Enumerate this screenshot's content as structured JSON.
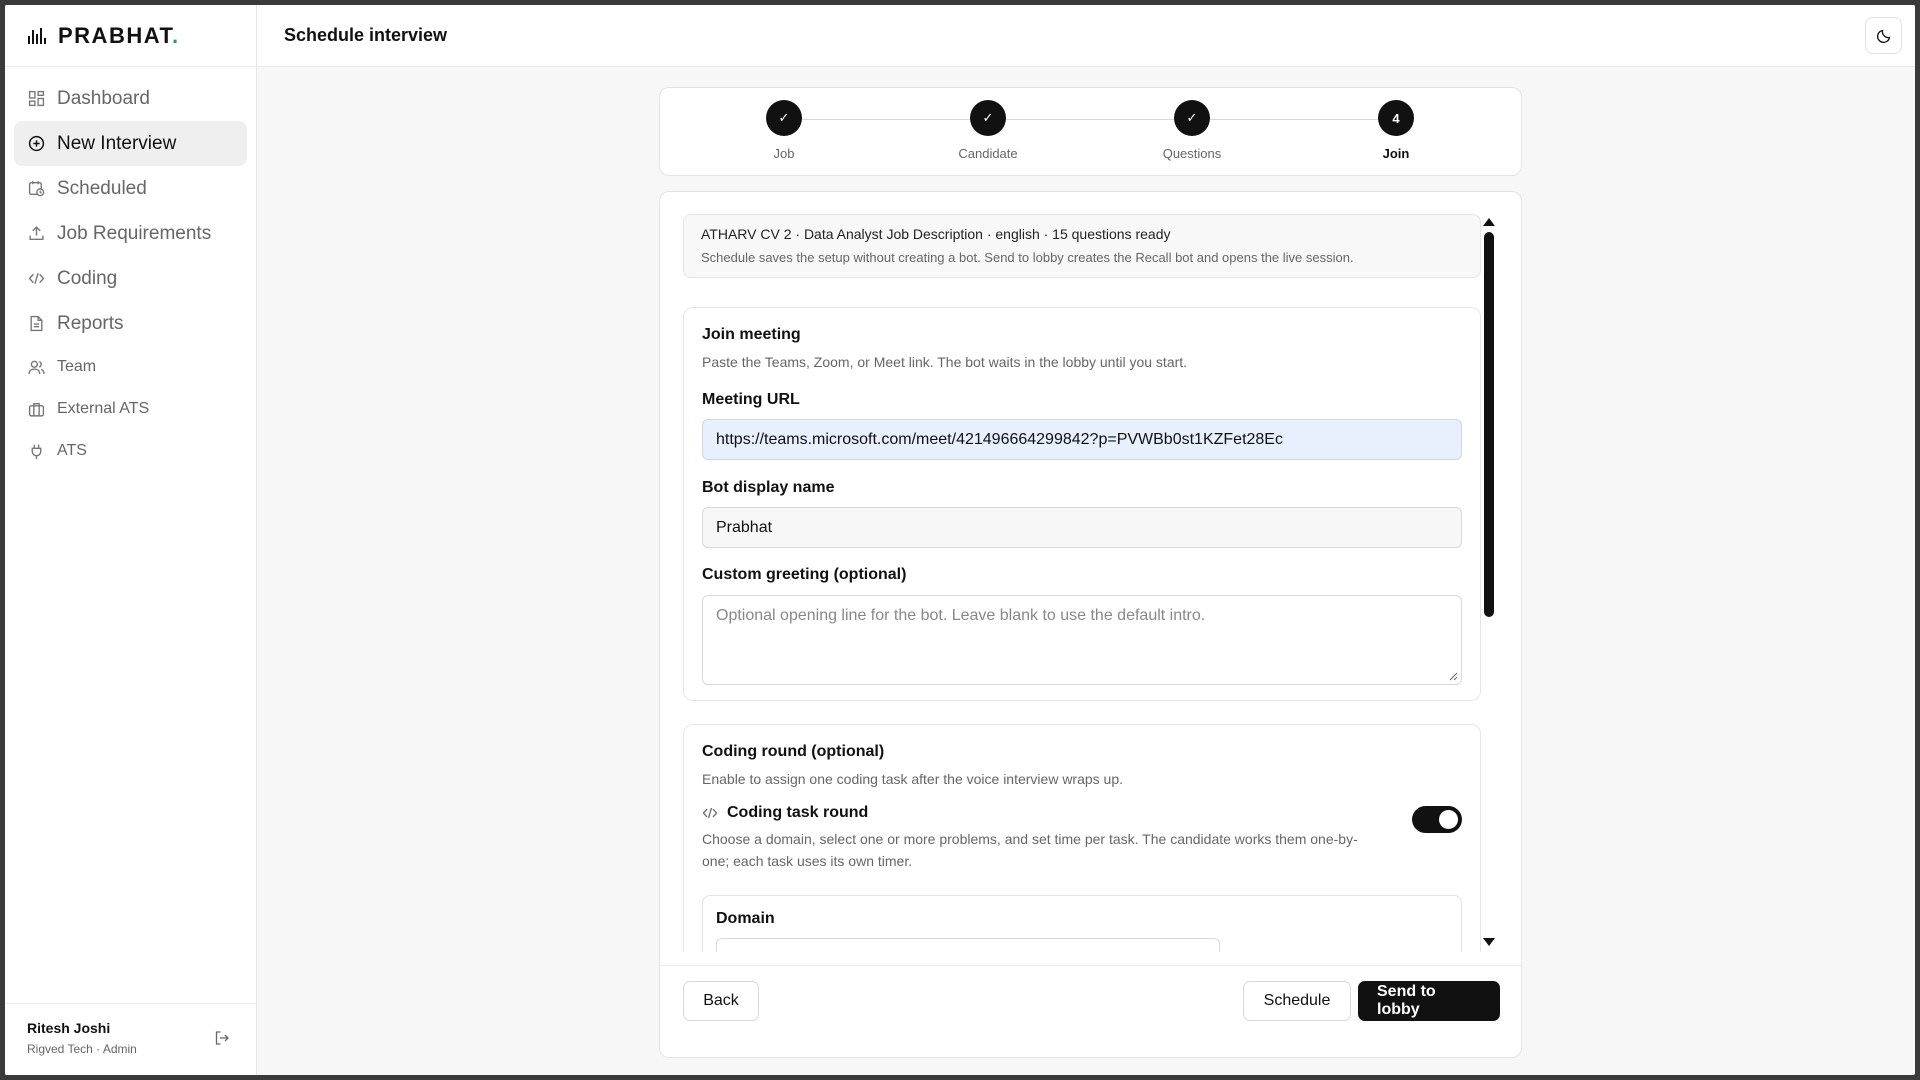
{
  "brand": {
    "name": "PRABHAT",
    "dot": "."
  },
  "sidebar": {
    "items": [
      {
        "label": "Dashboard",
        "icon": "dashboard-icon"
      },
      {
        "label": "New Interview",
        "icon": "plus-circle-icon",
        "active": true
      },
      {
        "label": "Scheduled",
        "icon": "calendar-clock-icon"
      },
      {
        "label": "Job Requirements",
        "icon": "upload-icon"
      },
      {
        "label": "Coding",
        "icon": "code-icon"
      },
      {
        "label": "Reports",
        "icon": "document-icon"
      },
      {
        "label": "Team",
        "icon": "users-icon"
      },
      {
        "label": "External ATS",
        "icon": "briefcase-icon"
      },
      {
        "label": "ATS",
        "icon": "plug-icon"
      }
    ],
    "user": {
      "name": "Ritesh Joshi",
      "role": "Rigved Tech · Admin"
    }
  },
  "header": {
    "title": "Schedule interview"
  },
  "stepper": {
    "steps": [
      {
        "label": "Job",
        "state": "done",
        "mark": "✓"
      },
      {
        "label": "Candidate",
        "state": "done",
        "mark": "✓"
      },
      {
        "label": "Questions",
        "state": "done",
        "mark": "✓"
      },
      {
        "label": "Join",
        "state": "current",
        "mark": "4"
      }
    ]
  },
  "summary": {
    "title": "ATHARV CV 2 · Data Analyst Job Description · english · 15 questions ready",
    "subtitle": "Schedule saves the setup without creating a bot. Send to lobby creates the Recall bot and opens the live session."
  },
  "join_meeting": {
    "title": "Join meeting",
    "description": "Paste the Teams, Zoom, or Meet link. The bot waits in the lobby until you start.",
    "meeting_url_label": "Meeting URL",
    "meeting_url_value": "https://teams.microsoft.com/meet/421496664299842?p=PVWBb0st1KZFet28Ec",
    "bot_name_label": "Bot display name",
    "bot_name_value": "Prabhat",
    "greeting_label": "Custom greeting (optional)",
    "greeting_placeholder": "Optional opening line for the bot. Leave blank to use the default intro."
  },
  "coding_round": {
    "title": "Coding round (optional)",
    "description": "Enable to assign one coding task after the voice interview wraps up.",
    "task_label": "Coding task round",
    "task_description": "Choose a domain, select one or more problems, and set time per task. The candidate works them one-by-one; each task uses its own timer.",
    "enabled": true,
    "domain_label": "Domain"
  },
  "footer": {
    "back_label": "Back",
    "schedule_label": "Schedule",
    "send_label": "Send to lobby"
  },
  "colors": {
    "accent": "#111111",
    "brand_dot": "#22a06b",
    "url_field_bg": "#e8f0fe"
  }
}
